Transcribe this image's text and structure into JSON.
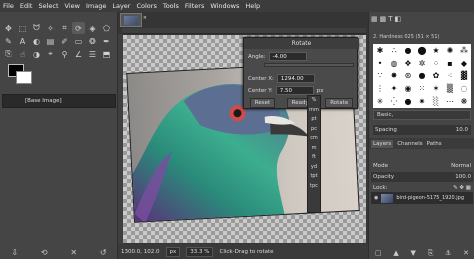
{
  "menu": [
    "File",
    "Edit",
    "Select",
    "View",
    "Image",
    "Layer",
    "Colors",
    "Tools",
    "Filters",
    "Windows",
    "Help"
  ],
  "images_panel": {
    "item": "[Base Image]"
  },
  "rotate": {
    "title": "Rotate",
    "angle_label": "Angle:",
    "angle_value": "-4.00",
    "center_x_label": "Center X:",
    "center_x_value": "1294.00",
    "center_y_label": "Center Y:",
    "center_y_value": "7.50",
    "unit": "px",
    "reset": "Reset",
    "ready": "Ready",
    "rotate_btn": "Rotate"
  },
  "units": [
    "%",
    "mm",
    "pt",
    "pc",
    "cm",
    "m",
    "ft",
    "yd",
    "tpt",
    "tpc"
  ],
  "status": {
    "coords": "1300.0, 102.0",
    "unit": "px",
    "zoom": "33.3 %",
    "message": "Click-Drag to rotate"
  },
  "brushes": {
    "label": "2. Hardness 025 (51 × 51)",
    "preset": "Basic,",
    "spacing_label": "Spacing",
    "spacing_value": "10.0"
  },
  "layers": {
    "tabs": [
      "Layers",
      "Channels",
      "Paths"
    ],
    "mode_label": "Mode",
    "mode_value": "Normal",
    "opacity_label": "Opacity",
    "opacity_value": "100.0",
    "lock_label": "Lock:",
    "layer_name": "bird-pigeon-5175_1920.jpg"
  }
}
